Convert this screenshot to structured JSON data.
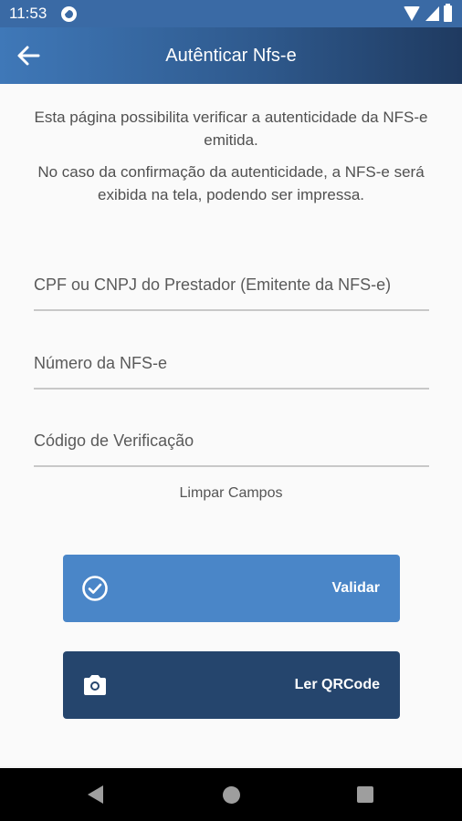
{
  "status_bar": {
    "time": "11:53"
  },
  "app_bar": {
    "title": "Autênticar Nfs-e"
  },
  "description": {
    "line1": "Esta página possibilita verificar a autenticidade da NFS-e emitida.",
    "line2": "No caso da confirmação da autenticidade, a NFS-e será exibida na tela, podendo ser impressa."
  },
  "form": {
    "cpf_cnpj_placeholder": "CPF ou CNPJ do Prestador (Emitente da NFS-e)",
    "numero_placeholder": "Número da NFS-e",
    "codigo_placeholder": "Código de Verificação",
    "cpf_cnpj_value": "",
    "numero_value": "",
    "codigo_value": ""
  },
  "actions": {
    "clear_label": "Limpar Campos",
    "validar_label": "Validar",
    "validar_icon": "check-circle-icon",
    "qrcode_label": "Ler QRCode",
    "qrcode_icon": "camera-icon"
  },
  "colors": {
    "primary": "#4a86c8",
    "dark": "#25456d",
    "status_bar": "#3a6aa5"
  }
}
